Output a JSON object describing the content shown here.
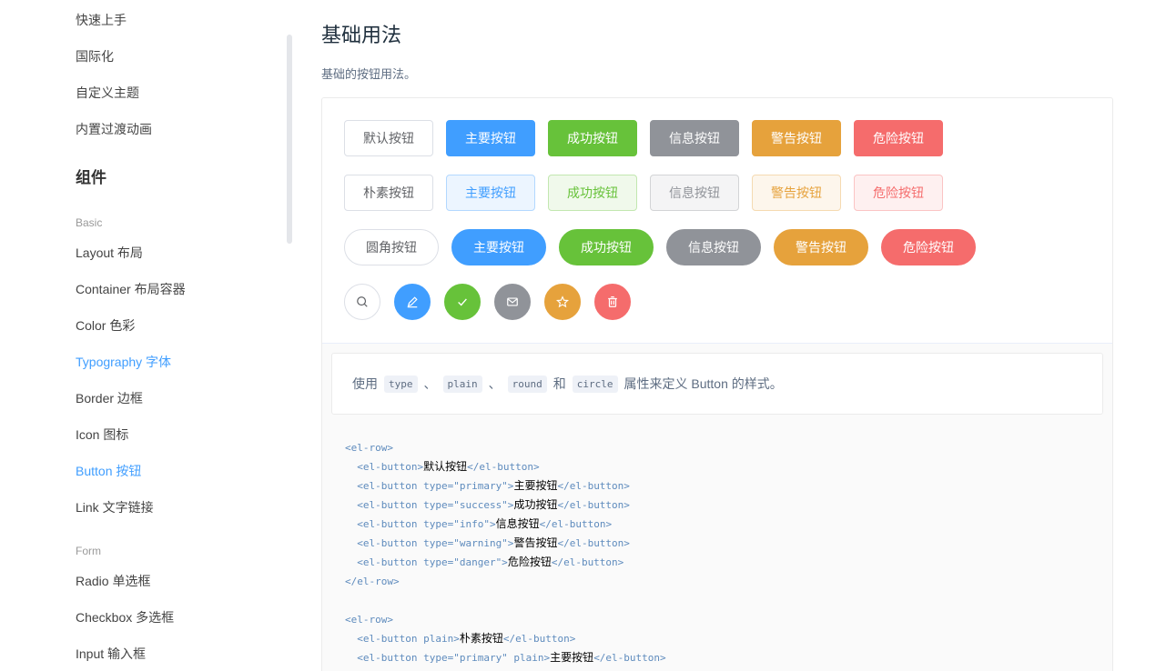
{
  "sidebar": {
    "items_top": [
      "快速上手",
      "国际化",
      "自定义主题",
      "内置过渡动画"
    ],
    "group_title": "组件",
    "sub_basic": "Basic",
    "items_basic": [
      "Layout 布局",
      "Container 布局容器",
      "Color 色彩",
      "Typography 字体",
      "Border 边框",
      "Icon 图标",
      "Button 按钮",
      "Link 文字链接"
    ],
    "sub_form": "Form",
    "items_form": [
      "Radio 单选框",
      "Checkbox 多选框",
      "Input 输入框"
    ]
  },
  "main": {
    "title": "基础用法",
    "desc": "基础的按钮用法。",
    "row1": [
      "默认按钮",
      "主要按钮",
      "成功按钮",
      "信息按钮",
      "警告按钮",
      "危险按钮"
    ],
    "row2": [
      "朴素按钮",
      "主要按钮",
      "成功按钮",
      "信息按钮",
      "警告按钮",
      "危险按钮"
    ],
    "row3": [
      "圆角按钮",
      "主要按钮",
      "成功按钮",
      "信息按钮",
      "警告按钮",
      "危险按钮"
    ],
    "icons": [
      "search-icon",
      "edit-icon",
      "check-icon",
      "message-icon",
      "star-icon",
      "delete-icon"
    ],
    "description": {
      "prefix": "使用",
      "code1": "type",
      "sep1": "、",
      "code2": "plain",
      "sep2": "、",
      "code3": "round",
      "and": "和",
      "code4": "circle",
      "suffix": "属性来定义 Button 的样式。"
    },
    "code_lines": [
      {
        "tag": "<el-row>"
      },
      {
        "tag": "  <el-button>",
        "text": "默认按钮",
        "close": "</el-button>"
      },
      {
        "tag": "  <el-button type=\"primary\">",
        "text": "主要按钮",
        "close": "</el-button>"
      },
      {
        "tag": "  <el-button type=\"success\">",
        "text": "成功按钮",
        "close": "</el-button>"
      },
      {
        "tag": "  <el-button type=\"info\">",
        "text": "信息按钮",
        "close": "</el-button>"
      },
      {
        "tag": "  <el-button type=\"warning\">",
        "text": "警告按钮",
        "close": "</el-button>"
      },
      {
        "tag": "  <el-button type=\"danger\">",
        "text": "危险按钮",
        "close": "</el-button>"
      },
      {
        "tag": "</el-row>"
      },
      {
        "tag": ""
      },
      {
        "tag": "<el-row>"
      },
      {
        "tag": "  <el-button plain>",
        "text": "朴素按钮",
        "close": "</el-button>"
      },
      {
        "tag": "  <el-button type=\"primary\" plain>",
        "text": "主要按钮",
        "close": "</el-button>"
      }
    ]
  }
}
